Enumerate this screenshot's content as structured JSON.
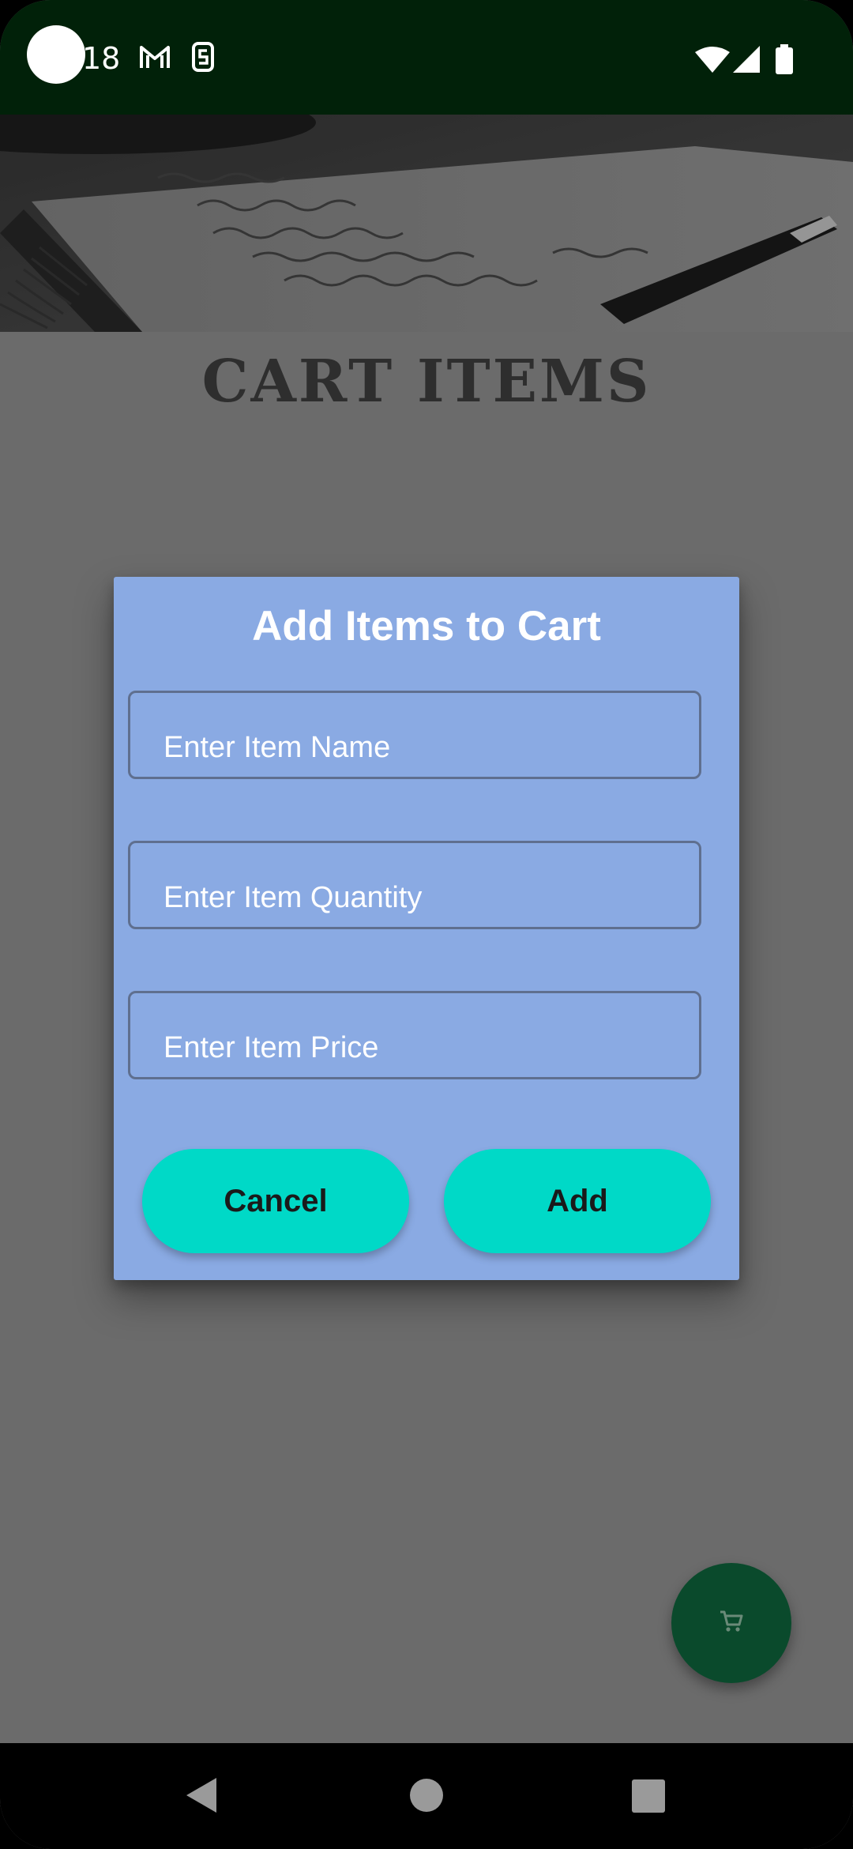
{
  "status_bar": {
    "time": "18",
    "icons": [
      "gmail-icon",
      "notification-s-icon",
      "wifi-icon",
      "signal-icon",
      "battery-icon"
    ]
  },
  "page": {
    "title": "CART ITEMS",
    "header_image": "notebook-with-pen-photo"
  },
  "dialog": {
    "title": "Add Items to Cart",
    "fields": {
      "name_placeholder": "Enter Item Name",
      "quantity_placeholder": "Enter Item Quantity",
      "price_placeholder": "Enter Item Price"
    },
    "cancel_label": "Cancel",
    "add_label": "Add"
  },
  "fab": {
    "icon": "cart-icon"
  },
  "nav_bar": {
    "icons": [
      "back-icon",
      "home-icon",
      "recents-icon"
    ]
  },
  "colors": {
    "status_bar": "#012109",
    "dialog_background": "#8aaae3",
    "button": "#00d9c7",
    "fab": "#0a4a2c",
    "scrim": "#6b6b6b"
  }
}
